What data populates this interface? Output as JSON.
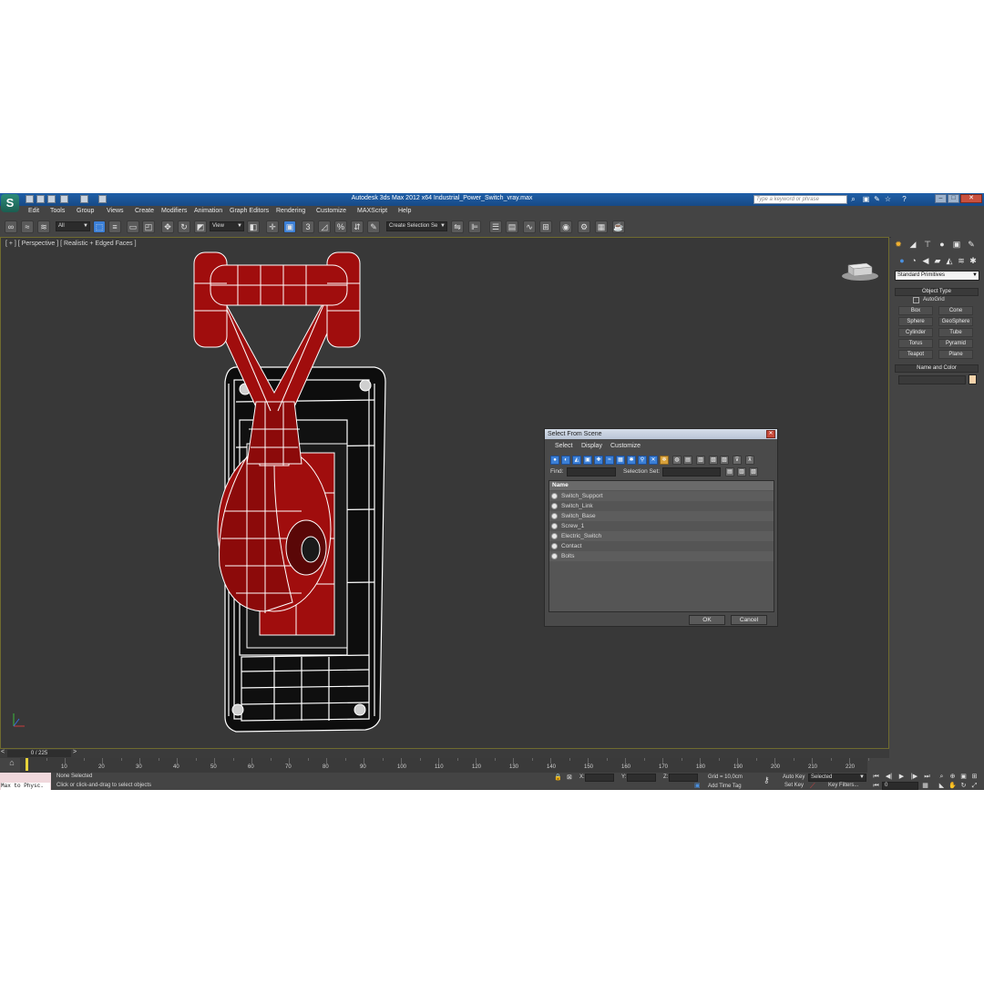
{
  "window": {
    "title": "Autodesk 3ds Max  2012 x64      Industrial_Power_Switch_vray.max",
    "search_placeholder": "Type a keyword or phrase"
  },
  "menu": [
    "Edit",
    "Tools",
    "Group",
    "Views",
    "Create",
    "Modifiers",
    "Animation",
    "Graph Editors",
    "Rendering",
    "Customize",
    "MAXScript",
    "Help"
  ],
  "toolbar": {
    "selection_filter": "All",
    "reference_coord": "View",
    "snap_angle_label": "3",
    "named_selection": "Create Selection Se"
  },
  "viewport": {
    "label": "[ + ] [ Perspective ] [ Realistic + Edged Faces ]",
    "object_color": "#a00d0d"
  },
  "command_panel": {
    "category": "Standard Primitives",
    "object_type_title": "Object Type",
    "autogrid_label": "AutoGrid",
    "primitives": [
      "Box",
      "Cone",
      "Sphere",
      "GeoSphere",
      "Cylinder",
      "Tube",
      "Torus",
      "Pyramid",
      "Teapot",
      "Plane"
    ],
    "name_color_title": "Name and Color",
    "object_color": "#f5d3ab"
  },
  "dialog": {
    "title": "Select From Scene",
    "menus": [
      "Select",
      "Display",
      "Customize"
    ],
    "find_label": "Find:",
    "selection_set_label": "Selection Set:",
    "column_header": "Name",
    "items": [
      "Switch_Support",
      "Switch_Link",
      "Switch_Base",
      "Screw_1",
      "Electric_Switch",
      "Contact",
      "Bolts"
    ],
    "ok_label": "OK",
    "cancel_label": "Cancel"
  },
  "timeline": {
    "frame_indicator": "0 / 225",
    "tick_labels": [
      "10",
      "20",
      "30",
      "40",
      "50",
      "60",
      "70",
      "80",
      "90",
      "100",
      "110",
      "120",
      "130",
      "140",
      "150",
      "160",
      "170",
      "180",
      "190",
      "200",
      "210",
      "220"
    ]
  },
  "status": {
    "maxscript_text": "Max to Physc.",
    "selection_text": "None Selected",
    "prompt_text": "Click or click-and-drag to select objects",
    "x_label": "X:",
    "y_label": "Y:",
    "z_label": "Z:",
    "grid_text": "Grid = 10,0cm",
    "add_time_tag": "Add Time Tag",
    "auto_key": "Auto Key",
    "set_key": "Set Key",
    "key_mode": "Selected",
    "key_filters": "Key Filters...",
    "current_frame": "0"
  }
}
